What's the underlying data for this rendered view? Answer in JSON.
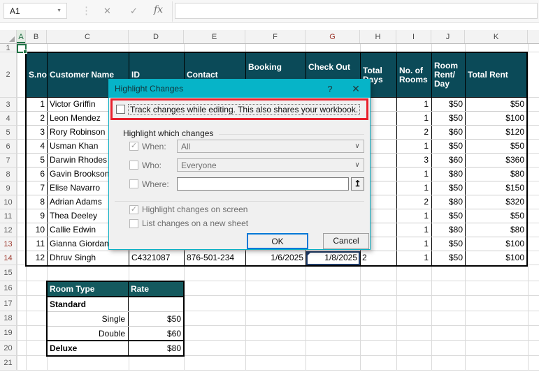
{
  "formula_bar": {
    "name_box": "A1",
    "fx_label": "fx",
    "formula_value": ""
  },
  "icons": {
    "cancel": "✕",
    "confirm": "✓",
    "dots": "⋮",
    "dropdown": "▼",
    "combo_chevron": "∨",
    "collapse": "↥",
    "check": "✓"
  },
  "sheet": {
    "column_letters": [
      "A",
      "B",
      "C",
      "D",
      "E",
      "F",
      "G",
      "H",
      "I",
      "J",
      "K"
    ],
    "row_numbers": [
      "1",
      "2",
      "3",
      "4",
      "5",
      "6",
      "7",
      "8",
      "9",
      "10",
      "11",
      "12",
      "13",
      "14",
      "15",
      "16",
      "17",
      "18",
      "19",
      "20",
      "21"
    ]
  },
  "table": {
    "headers": [
      "S.no",
      "Customer Name",
      "ID",
      "Contact",
      "Booking",
      "Check Out",
      "Total Days",
      "No. of Rooms",
      "Room Rent/ Day",
      "Total Rent"
    ],
    "rows": [
      {
        "sno": "1",
        "name": "Victor Griffin",
        "id": "",
        "contact": "",
        "booking": "",
        "checkout": "",
        "days": "",
        "rooms": "1",
        "rent": "$50",
        "total": "$50"
      },
      {
        "sno": "2",
        "name": "Leon Mendez",
        "id": "",
        "contact": "",
        "booking": "",
        "checkout": "",
        "days": "",
        "rooms": "1",
        "rent": "$50",
        "total": "$100"
      },
      {
        "sno": "3",
        "name": "Rory Robinson",
        "id": "",
        "contact": "",
        "booking": "",
        "checkout": "",
        "days": "",
        "rooms": "2",
        "rent": "$60",
        "total": "$120"
      },
      {
        "sno": "4",
        "name": "Usman Khan",
        "id": "",
        "contact": "",
        "booking": "",
        "checkout": "",
        "days": "",
        "rooms": "1",
        "rent": "$50",
        "total": "$50"
      },
      {
        "sno": "5",
        "name": "Darwin Rhodes",
        "id": "",
        "contact": "",
        "booking": "",
        "checkout": "",
        "days": "",
        "rooms": "3",
        "rent": "$60",
        "total": "$360"
      },
      {
        "sno": "6",
        "name": "Gavin Brookson",
        "id": "",
        "contact": "",
        "booking": "",
        "checkout": "",
        "days": "",
        "rooms": "1",
        "rent": "$80",
        "total": "$80"
      },
      {
        "sno": "7",
        "name": "Elise Navarro",
        "id": "",
        "contact": "",
        "booking": "",
        "checkout": "",
        "days": "",
        "rooms": "1",
        "rent": "$50",
        "total": "$150"
      },
      {
        "sno": "8",
        "name": "Adrian Adams",
        "id": "",
        "contact": "",
        "booking": "",
        "checkout": "",
        "days": "",
        "rooms": "2",
        "rent": "$80",
        "total": "$320"
      },
      {
        "sno": "9",
        "name": "Thea Deeley",
        "id": "",
        "contact": "",
        "booking": "",
        "checkout": "",
        "days": "",
        "rooms": "1",
        "rent": "$50",
        "total": "$50"
      },
      {
        "sno": "10",
        "name": "Callie Edwin",
        "id": "",
        "contact": "",
        "booking": "",
        "checkout": "",
        "days": "",
        "rooms": "1",
        "rent": "$80",
        "total": "$80"
      },
      {
        "sno": "11",
        "name": "Gianna Giordana",
        "id": "",
        "contact": "",
        "booking": "",
        "checkout": "",
        "days": "",
        "rooms": "1",
        "rent": "$50",
        "total": "$100"
      },
      {
        "sno": "12",
        "name": "Dhruv Singh",
        "id": "C4321087",
        "contact": "876-501-234",
        "booking": "1/6/2025",
        "checkout": "1/8/2025",
        "days": "2",
        "rooms": "1",
        "rent": "$50",
        "total": "$100"
      }
    ]
  },
  "room_table": {
    "headers": [
      "Room Type",
      "Rate"
    ],
    "rows": [
      {
        "type": "Standard",
        "rate": ""
      },
      {
        "type": "Single",
        "rate": "$50"
      },
      {
        "type": "Double",
        "rate": "$60"
      },
      {
        "type": "Deluxe",
        "rate": "$80"
      }
    ]
  },
  "dialog": {
    "title": "Highlight Changes",
    "help_label": "?",
    "close_label": "✕",
    "track_label": "Track changes while editing. This also shares your workbook.",
    "track_checked": false,
    "group_label": "Highlight which changes",
    "when_label": "When:",
    "when_value": "All",
    "when_checked": true,
    "who_label": "Who:",
    "who_value": "Everyone",
    "who_checked": false,
    "where_label": "Where:",
    "where_value": "",
    "where_checked": false,
    "screen_label": "Highlight changes on screen",
    "screen_checked": true,
    "sheet_label": "List changes on a new sheet",
    "sheet_checked": false,
    "ok_label": "OK",
    "cancel_label": "Cancel"
  },
  "colors": {
    "table_header_teal": "#0b4a58",
    "room_header_teal": "#14595e",
    "dialog_titlebar_teal": "#06b4c8",
    "annotation_red": "#e8202c",
    "changed_cell_navy": "#1e3a66",
    "selection_green": "#217346",
    "tracked_header_red": "#9e3a2f"
  }
}
